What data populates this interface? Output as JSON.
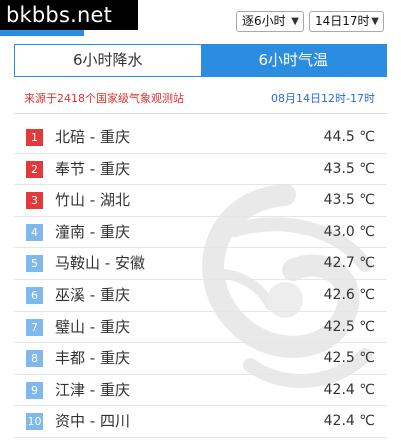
{
  "watermark": "bkbbs.net",
  "controls": {
    "interval_select": "逐6小时",
    "time_select": "14日17时"
  },
  "tabs": [
    {
      "label": "6小时降水",
      "active": false
    },
    {
      "label": "6小时气温",
      "active": true
    }
  ],
  "info": {
    "source": "来源于2418个国家级气象观测站",
    "period": "08月14日12时-17时"
  },
  "ranking": [
    {
      "rank": "1",
      "station": "北碚 - 重庆",
      "temp": "44.5 ℃"
    },
    {
      "rank": "2",
      "station": "奉节 - 重庆",
      "temp": "43.5 ℃"
    },
    {
      "rank": "3",
      "station": "竹山 - 湖北",
      "temp": "43.5 ℃"
    },
    {
      "rank": "4",
      "station": "潼南 - 重庆",
      "temp": "43.0 ℃"
    },
    {
      "rank": "5",
      "station": "马鞍山 - 安徽",
      "temp": "42.7 ℃"
    },
    {
      "rank": "6",
      "station": "巫溪 - 重庆",
      "temp": "42.6 ℃"
    },
    {
      "rank": "7",
      "station": "璧山 - 重庆",
      "temp": "42.5 ℃"
    },
    {
      "rank": "8",
      "station": "丰都 - 重庆",
      "temp": "42.5 ℃"
    },
    {
      "rank": "9",
      "station": "江津 - 重庆",
      "temp": "42.4 ℃"
    },
    {
      "rank": "10",
      "station": "资中 - 四川",
      "temp": "42.4 ℃"
    }
  ],
  "colors": {
    "accent": "#2a8de0",
    "top_rank": "#e03a3a",
    "other_rank": "#7fb8ea",
    "source_text": "#e03030",
    "period_text": "#2a6dd0"
  }
}
